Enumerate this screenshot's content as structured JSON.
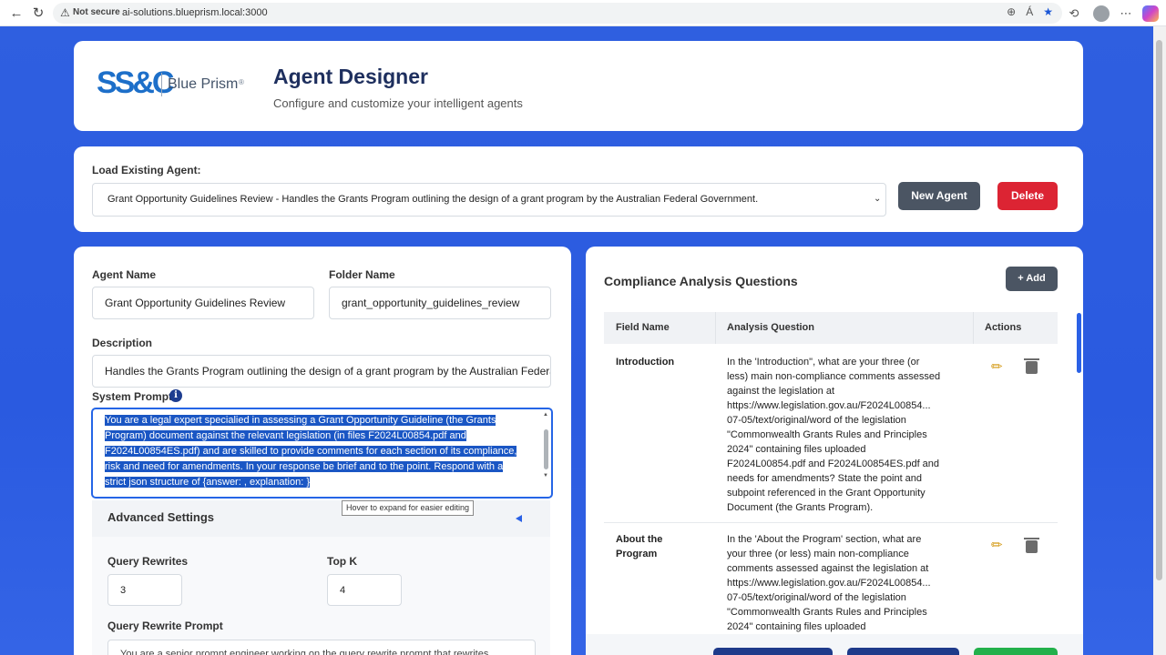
{
  "browser": {
    "not_secure": "Not secure",
    "url": "ai-solutions.blueprism.local:3000"
  },
  "header": {
    "logo_mark": "SS&C",
    "logo_brand": "Blue Prism",
    "logo_tm": "®",
    "title": "Agent Designer",
    "subtitle": "Configure and customize your intelligent agents"
  },
  "loader": {
    "label": "Load Existing Agent:",
    "selected": "Grant Opportunity Guidelines Review - Handles the Grants Program outlining the design of a grant program by the Australian Federal Government.",
    "new_label": "New Agent",
    "delete_label": "Delete"
  },
  "form": {
    "agent_name_label": "Agent Name",
    "agent_name_value": "Grant Opportunity Guidelines Review",
    "folder_name_label": "Folder Name",
    "folder_name_value": "grant_opportunity_guidelines_review",
    "description_label": "Description",
    "description_value": "Handles the Grants Program outlining the design of a grant program by the Australian Federal",
    "system_prompt_label": "System Prompt",
    "system_prompt_lines": [
      "You are a legal expert specialied in assessing a Grant Opportunity Guideline (the Grants",
      "Program) document against the relevant legislation (in files F2024L00854.pdf and",
      "F2024L00854ES.pdf) and are skilled to provide comments for each section of its compliance,",
      "risk and need for amendments. In your response be brief and to the point. Respond with a",
      "strict json structure of {answer: , explanation: }"
    ],
    "tooltip": "Hover to expand for easier editing",
    "advanced_title": "Advanced Settings",
    "query_rewrites_label": "Query Rewrites",
    "query_rewrites_value": "3",
    "top_k_label": "Top K",
    "top_k_value": "4",
    "query_rewrite_prompt_label": "Query Rewrite Prompt",
    "query_rewrite_prompt_value": "You are a senior prompt engineer working on the query rewrite prompt that rewrites"
  },
  "compliance": {
    "title": "Compliance Analysis Questions",
    "add_label": "+ Add",
    "columns": [
      "Field Name",
      "Analysis Question",
      "Actions"
    ],
    "rows": [
      {
        "field": [
          "Introduction"
        ],
        "question": [
          "In the 'Introduction\", what are your three (or",
          "less) main non-compliance comments assessed",
          "against the legislation at",
          "https://www.legislation.gov.au/F2024L00854...",
          "07-05/text/original/word of the legislation",
          "\"Commonwealth Grants Rules and Principles",
          "2024\" containing files uploaded",
          "F2024L00854.pdf and F2024L00854ES.pdf and",
          "needs for amendments? State the point and",
          "subpoint referenced in the Grant Opportunity",
          "Document (the Grants Program)."
        ]
      },
      {
        "field": [
          "About the",
          "Program"
        ],
        "question": [
          "In the 'About the Program' section, what are",
          "your three (or less) main non-compliance",
          "comments assessed against the legislation at",
          "https://www.legislation.gov.au/F2024L00854...",
          "07-05/text/original/word of the legislation",
          "\"Commonwealth Grants Rules and Principles",
          "2024\" containing files uploaded"
        ]
      }
    ]
  }
}
